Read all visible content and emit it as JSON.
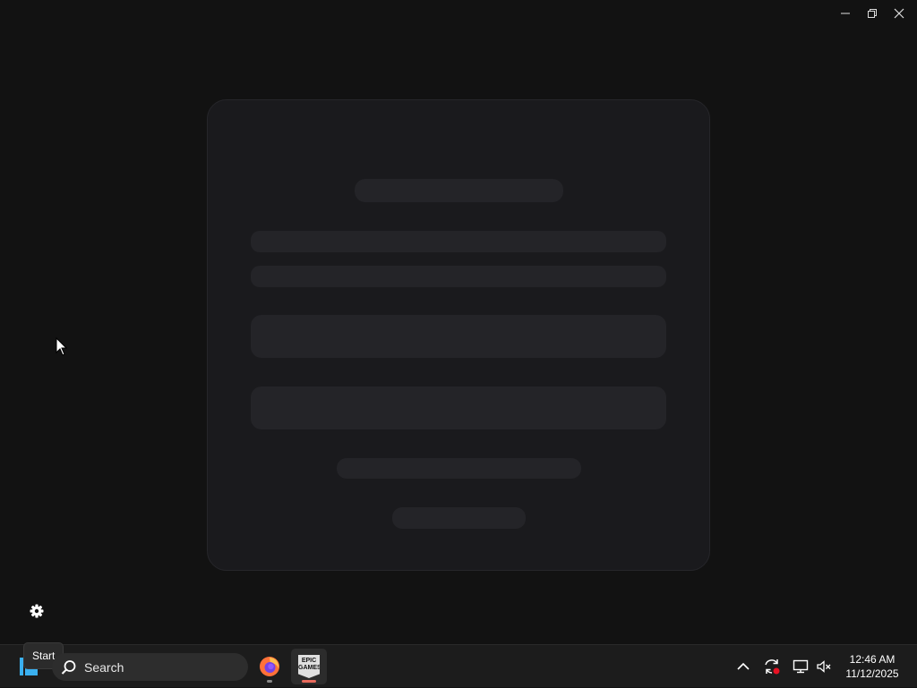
{
  "window": {
    "controls": [
      "minimize",
      "restore",
      "close"
    ]
  },
  "card": {
    "state": "loading"
  },
  "taskbar": {
    "start_tooltip": "Start",
    "search_placeholder": "Search",
    "apps": [
      {
        "name": "Firefox",
        "icon": "firefox-icon"
      },
      {
        "name": "Epic Games Launcher",
        "icon": "epic-games-icon",
        "logo_text": "EPIC GAMES"
      }
    ],
    "clock": {
      "time": "12:46 AM",
      "date": "11/12/2025"
    }
  },
  "colors": {
    "background": "#121212",
    "card": "#1a1a1d",
    "skeleton": "#242428",
    "taskbar": "#1c1c1c",
    "start_accent": "#3ab0f0",
    "epic_indicator": "#e86a5c"
  }
}
